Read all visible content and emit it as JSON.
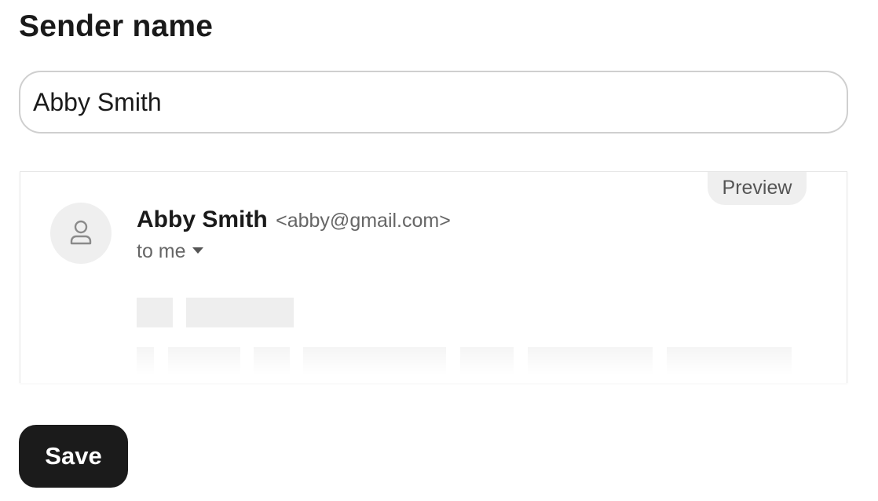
{
  "form": {
    "title": "Sender name",
    "name_input_value": "Abby Smith"
  },
  "preview": {
    "badge_label": "Preview",
    "avatar_icon": "person-icon",
    "sender_name": "Abby Smith",
    "sender_email": "<abby@gmail.com>",
    "recipient_label": "to me",
    "recipient_dropdown_icon": "caret-down-icon"
  },
  "actions": {
    "save_label": "Save"
  },
  "colors": {
    "primary_button": "#1b1b1b",
    "skeleton": "#eeeeee",
    "muted_text": "#666666"
  }
}
